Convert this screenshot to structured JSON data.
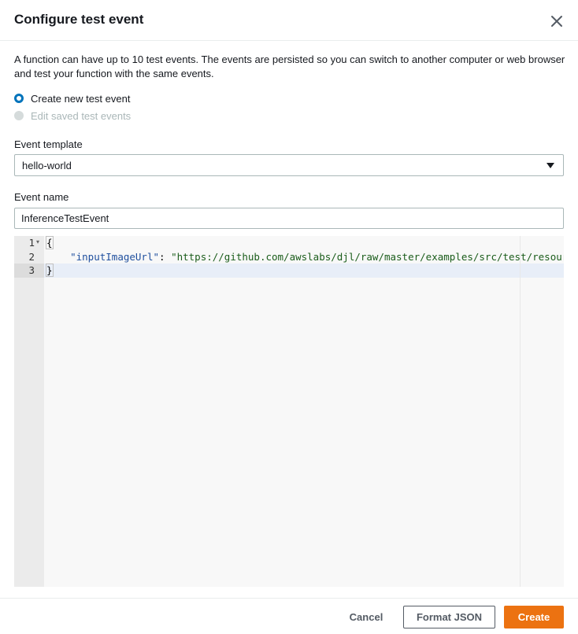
{
  "dialog": {
    "title": "Configure test event",
    "close_icon": "close-icon",
    "description": "A function can have up to 10 test events. The events are persisted so you can switch to another computer or web browser and test your function with the same events."
  },
  "options": {
    "create_new": "Create new test event",
    "edit_saved": "Edit saved test events",
    "selected": "Create new test event"
  },
  "template": {
    "label": "Event template",
    "value": "hello-world"
  },
  "event_name": {
    "label": "Event name",
    "value": "InferenceTestEvent"
  },
  "editor": {
    "line_numbers": [
      "1",
      "2",
      "3"
    ],
    "line1": "{",
    "line2_indent": "    ",
    "line2_key": "\"inputImageUrl\"",
    "line2_sep": ": ",
    "line2_value": "\"https://github.com/awslabs/djl/raw/master/examples/src/test/resour",
    "line3": "}"
  },
  "footer": {
    "cancel_label": "Cancel",
    "format_label": "Format JSON",
    "create_label": "Create"
  },
  "colors": {
    "accent": "#0073bb",
    "primary_button": "#ec7211"
  }
}
